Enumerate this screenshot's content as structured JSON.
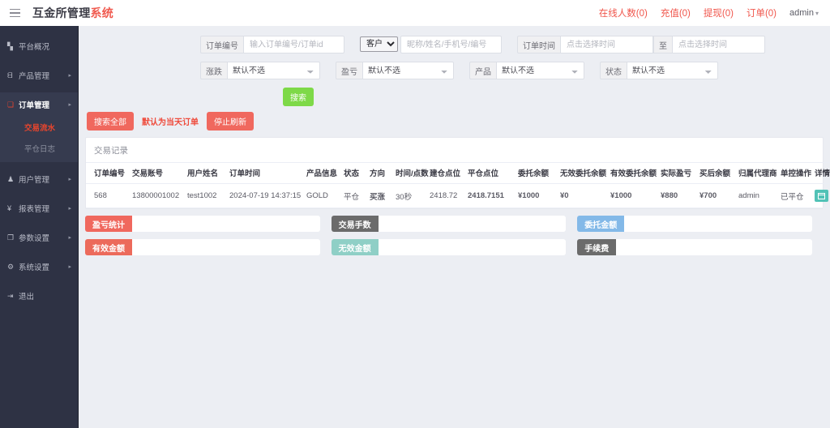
{
  "header": {
    "menu_icon": "hamburger-icon",
    "brand_main": "互金所管理",
    "brand_accent": "系统",
    "links": [
      {
        "label": "在线人数(0)"
      },
      {
        "label": "充值(0)"
      },
      {
        "label": "提现(0)"
      },
      {
        "label": "订单(0)"
      }
    ],
    "user": "admin",
    "user_caret": "▾"
  },
  "sidebar": {
    "items": [
      {
        "label": "平台概况",
        "icon": "dashboard-icon",
        "glyph": "▚",
        "arrow": ""
      },
      {
        "label": "产品管理",
        "icon": "product-icon",
        "glyph": "ᗺ",
        "arrow": "▸"
      },
      {
        "label": "订单管理",
        "icon": "order-icon",
        "glyph": "❏",
        "arrow": "▸"
      },
      {
        "label": "用户管理",
        "icon": "user-icon",
        "glyph": "♟",
        "arrow": "▸"
      },
      {
        "label": "报表管理",
        "icon": "report-icon",
        "glyph": "¥",
        "arrow": "▸"
      },
      {
        "label": "参数设置",
        "icon": "params-icon",
        "glyph": "❐",
        "arrow": "▸"
      },
      {
        "label": "系统设置",
        "icon": "system-settings-icon",
        "glyph": "⚙",
        "arrow": "▸"
      },
      {
        "label": "退出",
        "icon": "logout-icon",
        "glyph": "⇥",
        "arrow": ""
      }
    ],
    "order_submenu": [
      {
        "label": "交易流水",
        "active": true
      },
      {
        "label": "平仓日志",
        "active": false
      }
    ]
  },
  "filters": {
    "order_no": {
      "label": "订单编号",
      "placeholder": "输入订单编号/订单id",
      "value": ""
    },
    "customer": {
      "select_value": "客户",
      "placeholder": "昵称/姓名/手机号/编号",
      "value": ""
    },
    "order_time": {
      "label": "订单时间",
      "start_placeholder": "点击选择时间",
      "separator": "至",
      "end_placeholder": "点击选择时间"
    },
    "updown": {
      "label": "涨跌",
      "value": "默认不选"
    },
    "profit": {
      "label": "盈亏",
      "value": "默认不选"
    },
    "product": {
      "label": "产品",
      "value": "默认不选"
    },
    "status": {
      "label": "状态",
      "value": "默认不选"
    }
  },
  "actions": {
    "search": "搜索",
    "search_all": "搜索全部",
    "note": "默认为当天订单",
    "stop_refresh": "停止刷新"
  },
  "table": {
    "title": "交易记录",
    "columns": [
      "订单编号",
      "交易账号",
      "用户姓名",
      "订单时间",
      "产品信息",
      "状态",
      "方向",
      "时间/点数",
      "建仓点位",
      "平仓点位",
      "委托余额",
      "无效委托余额",
      "有效委托余额",
      "实际盈亏",
      "买后余额",
      "归属代理商",
      "单控操作",
      "详情"
    ],
    "rows": [
      {
        "order_no": "568",
        "account": "13800001002",
        "user_name": "test1002",
        "order_time": "2024-07-19 14:37:15",
        "product": "GOLD",
        "status": "平仓",
        "direction": "买涨",
        "time_points": "30秒",
        "open_price": "2418.72",
        "close_price": "2418.7151",
        "entrust_balance": "¥1000",
        "invalid_entrust_balance": "¥0",
        "valid_entrust_balance": "¥1000",
        "actual_profit": "¥880",
        "balance_after": "¥700",
        "agent": "admin",
        "single_control": "已平仓",
        "detail_icon": "window-icon"
      }
    ]
  },
  "stats": [
    {
      "label": "盈亏统计",
      "value": "",
      "color": "#f0685e"
    },
    {
      "label": "交易手数",
      "value": "",
      "color": "#6b6b6b"
    },
    {
      "label": "委托金额",
      "value": "",
      "color": "#83b9e8"
    },
    {
      "label": "有效金额",
      "value": "",
      "color": "#ec6a5b"
    },
    {
      "label": "无效金额",
      "value": "",
      "color": "#8fcfc6"
    },
    {
      "label": "手续费",
      "value": "",
      "color": "#6b6b6b"
    }
  ]
}
